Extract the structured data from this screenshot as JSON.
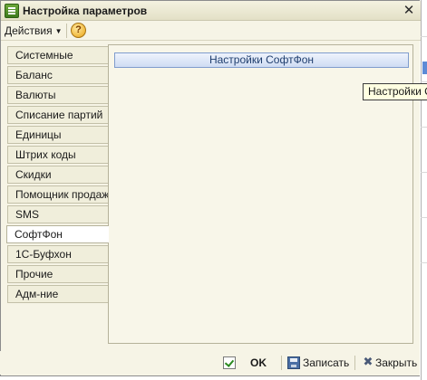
{
  "window": {
    "title": "Настройка параметров",
    "close_glyph": "✕"
  },
  "toolbar": {
    "actions_label": "Действия",
    "actions_caret": "▼",
    "help_glyph": "?"
  },
  "tabs": [
    {
      "label": "Системные",
      "active": false
    },
    {
      "label": "Баланс",
      "active": false
    },
    {
      "label": "Валюты",
      "active": false
    },
    {
      "label": "Списание партий",
      "active": false
    },
    {
      "label": "Единицы",
      "active": false
    },
    {
      "label": "Штрих коды",
      "active": false
    },
    {
      "label": "Скидки",
      "active": false
    },
    {
      "label": "Помощник продаж",
      "active": false
    },
    {
      "label": "SMS",
      "active": false
    },
    {
      "label": "СофтФон",
      "active": true
    },
    {
      "label": "1С-Буфхон",
      "active": false
    },
    {
      "label": "Прочие",
      "active": false
    },
    {
      "label": "Адм-ние",
      "active": false
    }
  ],
  "panel": {
    "softfon_button_label": "Настройки СофтФон"
  },
  "tooltip": {
    "text": "Настройки С"
  },
  "footer": {
    "ok_label": "OK",
    "save_label": "Записать",
    "close_label": "Закрыть",
    "close_glyph": "✖"
  },
  "colors": {
    "window_bg": "#f6f4e6",
    "button_border": "#7f9ccd",
    "tooltip_bg": "#ffffe1"
  },
  "icons": [
    "app-icon",
    "help-icon",
    "ok-icon",
    "save-icon",
    "close-icon"
  ]
}
